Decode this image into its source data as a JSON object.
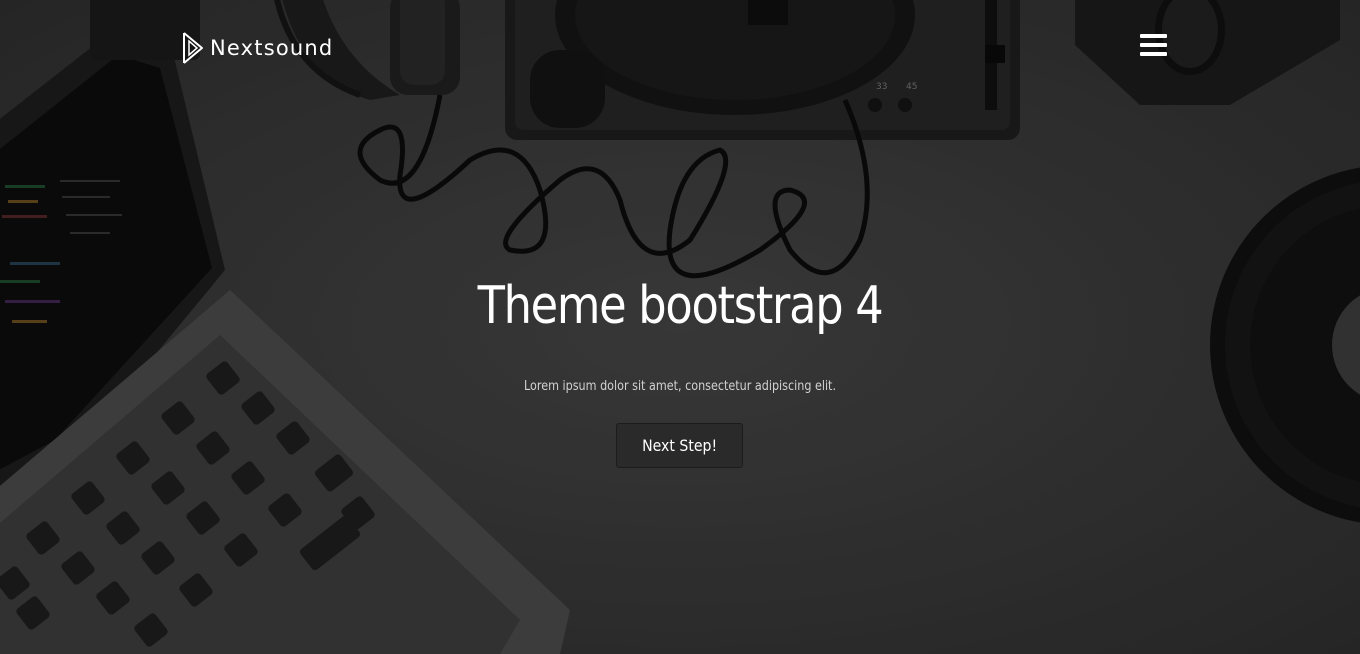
{
  "brand": {
    "name": "Nextsound",
    "logo_icon": "play-triangle-logo-icon"
  },
  "nav": {
    "menu_icon": "hamburger-menu-icon"
  },
  "hero": {
    "title": "Theme bootstrap 4",
    "subtitle": "Lorem ipsum dolor sit amet, consectetur adipiscing elit.",
    "cta_label": "Next Step!",
    "background_image": "dark desk with laptop, headphones, turntable, speaker and vinyl record"
  },
  "colors": {
    "overlay": "#3a3a3a",
    "text": "#ffffff",
    "subtitle_text": "#d2d2d2",
    "button_bg": "#2a2a2a"
  }
}
